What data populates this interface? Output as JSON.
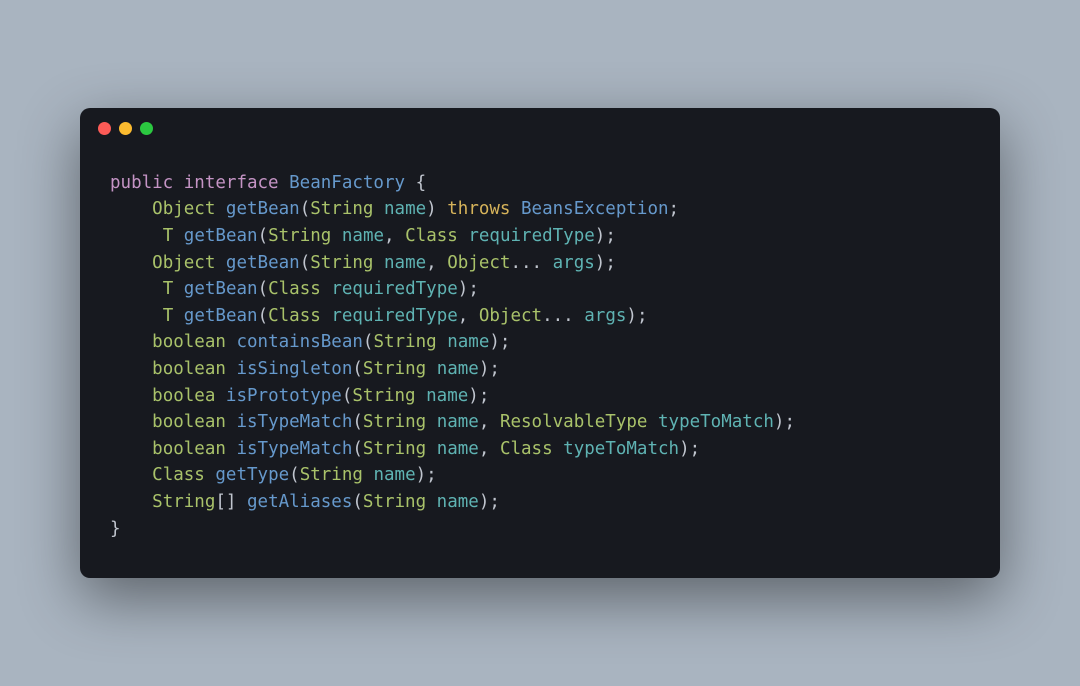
{
  "titlebar": {
    "dots": [
      "close",
      "minimize",
      "zoom"
    ]
  },
  "code": {
    "t_public": "public",
    "t_interface": "interface",
    "t_BeanFactory": "BeanFactory",
    "t_obrace": " {",
    "t_Object": "Object",
    "t_getBean": "getBean",
    "t_String": "String",
    "t_name": "name",
    "t_throws": "throws",
    "t_BeansException": "BeansException",
    "t_T": "T",
    "t_Class": "Class",
    "t_requiredType": "requiredType",
    "t_args": "args",
    "t_boolean": "boolean",
    "t_boolea": "boolea",
    "t_containsBean": "containsBean",
    "t_isSingleton": "isSingleton",
    "t_isPrototype": "isPrototype",
    "t_isTypeMatch": "isTypeMatch",
    "t_ResolvableType": "ResolvableType",
    "t_typeToMatch": "typeToMatch",
    "t_getType": "getType",
    "t_getAliases": "getAliases",
    "t_cbrace": "}",
    "t_dots": "...",
    "t_semi": ";",
    "t_comma": ",",
    "t_open": "(",
    "t_close": ")",
    "t_brackets": "[]",
    "t_space": " ",
    "t_indent": "    "
  }
}
